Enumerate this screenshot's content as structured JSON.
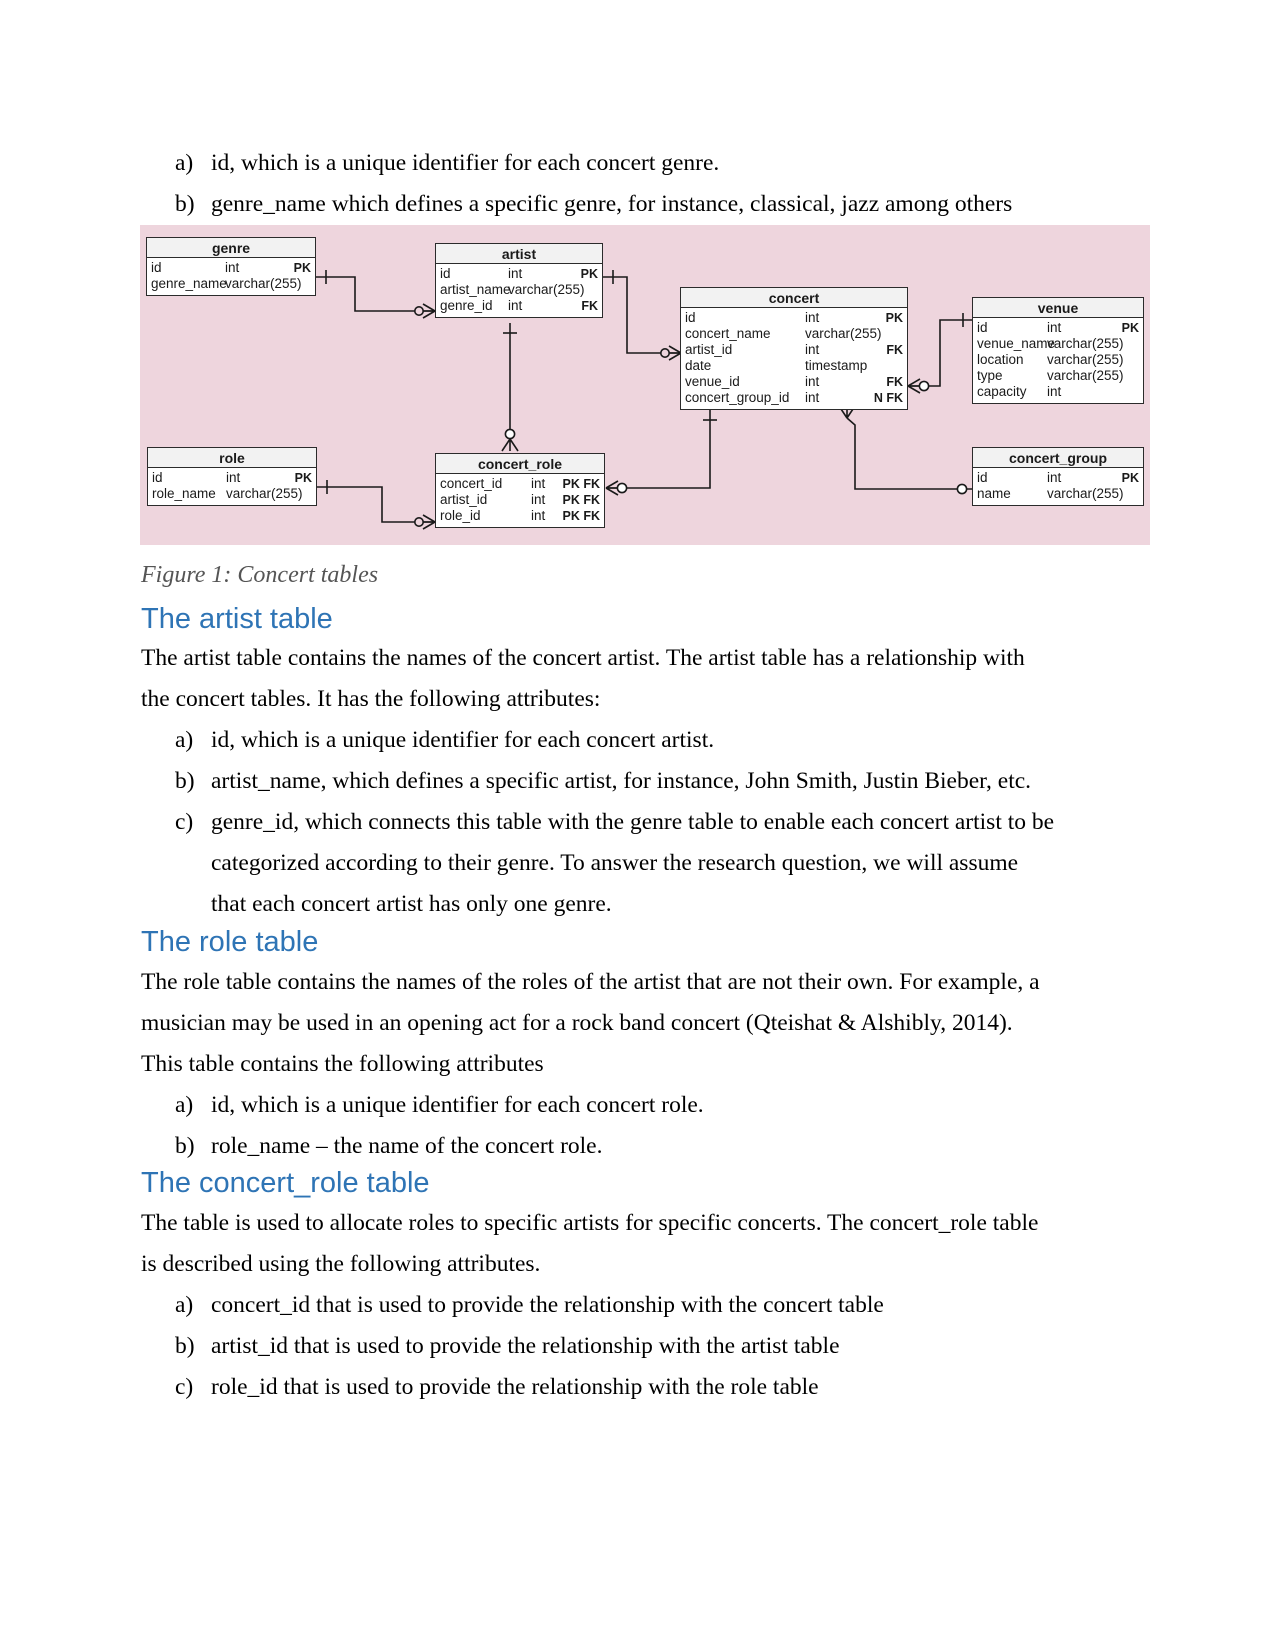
{
  "document": {
    "top_list": {
      "items": [
        {
          "marker": "a)",
          "text": "id, which is a unique identifier for each concert genre."
        },
        {
          "marker": "b)",
          "text": "genre_name which defines a specific genre, for instance, classical, jazz among others"
        }
      ]
    },
    "figure": {
      "caption": "Figure 1: Concert tables",
      "background_color": "#eed5dd"
    },
    "sections": [
      {
        "heading": "The artist table",
        "paragraph_lines": [
          "The artist table contains the names of the concert artist. The artist table has a relationship with",
          "the concert tables. It has the following attributes:"
        ],
        "list": [
          {
            "marker": "a)",
            "lines": [
              "id, which is a unique identifier for each concert artist."
            ]
          },
          {
            "marker": "b)",
            "lines": [
              "artist_name, which defines a specific artist, for instance, John Smith, Justin Bieber, etc."
            ]
          },
          {
            "marker": "c)",
            "lines": [
              "genre_id, which connects this table with the genre table to enable each concert artist to be",
              "categorized according to their genre. To answer the research question, we will assume",
              "that each concert artist has only one genre."
            ]
          }
        ]
      },
      {
        "heading": "The role table",
        "paragraph_lines": [
          "The role table contains the names of the roles of the artist that are not their own. For example, a",
          "musician may be used in an opening act for a rock band concert (Qteishat & Alshibly, 2014).",
          "This table contains the following attributes"
        ],
        "list": [
          {
            "marker": "a)",
            "lines": [
              "id, which is a unique identifier for each concert role."
            ]
          },
          {
            "marker": "b)",
            "lines": [
              "role_name – the name of the concert role."
            ]
          }
        ]
      },
      {
        "heading": "The concert_role table",
        "paragraph_lines": [
          "The table is used to allocate roles to specific artists for specific concerts. The concert_role table",
          "is described using the following attributes."
        ],
        "list": [
          {
            "marker": "a)",
            "lines": [
              "concert_id that is used to provide the relationship with the concert table"
            ]
          },
          {
            "marker": "b)",
            "lines": [
              "artist_id that is used to provide the relationship with the artist table"
            ]
          },
          {
            "marker": "c)",
            "lines": [
              "role_id that is used to provide the relationship with the role table"
            ]
          }
        ]
      }
    ],
    "heading_color": "#2E74B5"
  },
  "er_diagram": {
    "entities": [
      {
        "id": "genre",
        "title": "genre",
        "columns": [
          {
            "name": "id",
            "type": "int",
            "key": "PK"
          },
          {
            "name": "genre_name",
            "type": "varchar(255)",
            "key": ""
          }
        ]
      },
      {
        "id": "artist",
        "title": "artist",
        "columns": [
          {
            "name": "id",
            "type": "int",
            "key": "PK"
          },
          {
            "name": "artist_name",
            "type": "varchar(255)",
            "key": ""
          },
          {
            "name": "genre_id",
            "type": "int",
            "key": "FK"
          }
        ]
      },
      {
        "id": "concert",
        "title": "concert",
        "columns": [
          {
            "name": "id",
            "type": "int",
            "key": "PK"
          },
          {
            "name": "concert_name",
            "type": "varchar(255)",
            "key": ""
          },
          {
            "name": "artist_id",
            "type": "int",
            "key": "FK"
          },
          {
            "name": "date",
            "type": "timestamp",
            "key": ""
          },
          {
            "name": "venue_id",
            "type": "int",
            "key": "FK"
          },
          {
            "name": "concert_group_id",
            "type": "int",
            "key": "N FK"
          }
        ]
      },
      {
        "id": "venue",
        "title": "venue",
        "columns": [
          {
            "name": "id",
            "type": "int",
            "key": "PK"
          },
          {
            "name": "venue_name",
            "type": "varchar(255)",
            "key": ""
          },
          {
            "name": "location",
            "type": "varchar(255)",
            "key": ""
          },
          {
            "name": "type",
            "type": "varchar(255)",
            "key": ""
          },
          {
            "name": "capacity",
            "type": "int",
            "key": ""
          }
        ]
      },
      {
        "id": "role",
        "title": "role",
        "columns": [
          {
            "name": "id",
            "type": "int",
            "key": "PK"
          },
          {
            "name": "role_name",
            "type": "varchar(255)",
            "key": ""
          }
        ]
      },
      {
        "id": "concert_role",
        "title": "concert_role",
        "columns": [
          {
            "name": "concert_id",
            "type": "int",
            "key": "PK FK"
          },
          {
            "name": "artist_id",
            "type": "int",
            "key": "PK FK"
          },
          {
            "name": "role_id",
            "type": "int",
            "key": "PK FK"
          }
        ]
      },
      {
        "id": "concert_group",
        "title": "concert_group",
        "columns": [
          {
            "name": "id",
            "type": "int",
            "key": "PK"
          },
          {
            "name": "name",
            "type": "varchar(255)",
            "key": ""
          }
        ]
      }
    ],
    "relationships": [
      {
        "from": "genre",
        "to": "artist",
        "label": "one-to-many"
      },
      {
        "from": "artist",
        "to": "concert",
        "label": "one-to-many"
      },
      {
        "from": "venue",
        "to": "concert",
        "label": "one-to-many"
      },
      {
        "from": "concert_group",
        "to": "concert",
        "label": "one-to-many"
      },
      {
        "from": "concert",
        "to": "concert_role",
        "label": "one-to-many"
      },
      {
        "from": "artist",
        "to": "concert_role",
        "label": "one-to-many"
      },
      {
        "from": "role",
        "to": "concert_role",
        "label": "one-to-many"
      }
    ]
  }
}
